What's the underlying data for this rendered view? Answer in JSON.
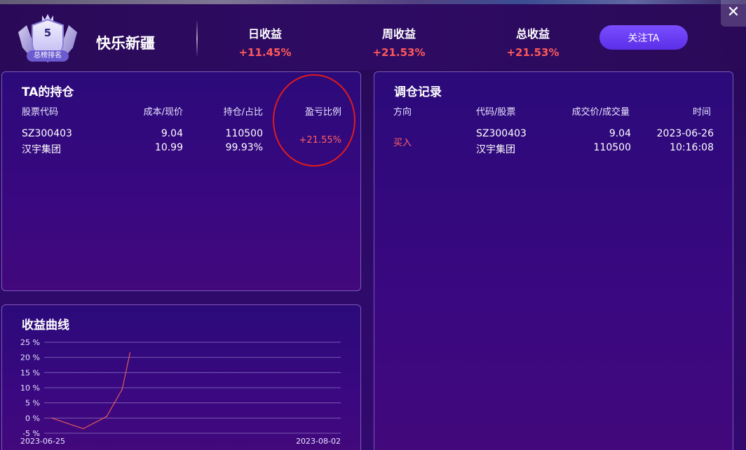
{
  "header": {
    "rank_number": "5",
    "rank_label": "总榜排名",
    "username": "快乐新疆",
    "stats": [
      {
        "label": "日收益",
        "value": "+11.45%"
      },
      {
        "label": "周收益",
        "value": "+21.53%"
      },
      {
        "label": "总收益",
        "value": "+21.53%"
      }
    ],
    "follow_label": "关注TA",
    "close_label": "✕"
  },
  "holdings": {
    "title": "TA的持仓",
    "columns": [
      "股票代码",
      "成本/现价",
      "持仓/占比",
      "盈亏比例"
    ],
    "rows": [
      {
        "code": "SZ300403",
        "name": "汉宇集团",
        "cost": "9.04",
        "price": "10.99",
        "position": "110500",
        "ratio": "99.93%",
        "pnl": "+21.55%"
      }
    ]
  },
  "records": {
    "title": "调仓记录",
    "columns": [
      "方向",
      "代码/股票",
      "成交价/成交量",
      "时间"
    ],
    "rows": [
      {
        "direction": "买入",
        "code": "SZ300403",
        "name": "汉宇集团",
        "price": "9.04",
        "volume": "110500",
        "date": "2023-06-26",
        "time": "10:16:08"
      }
    ]
  },
  "curve": {
    "title": "收益曲线"
  },
  "chart_data": {
    "type": "line",
    "title": "收益曲线",
    "ylim": [
      -5,
      25
    ],
    "yticks": [
      -5,
      0,
      5,
      10,
      15,
      20,
      25
    ],
    "ytick_labels": [
      "-5 %",
      "0 %",
      "5 %",
      "10 %",
      "15 %",
      "20 %",
      "25 %"
    ],
    "xlim": [
      "2023-06-25",
      "2023-08-02"
    ],
    "xtick_labels": [
      "2023-06-25",
      "2023-08-02"
    ],
    "grid": true,
    "series": [
      {
        "color": "#e05a5a",
        "x": [
          "2023-06-26",
          "2023-06-28",
          "2023-06-30",
          "2023-07-03",
          "2023-07-04",
          "2023-07-05",
          "2023-07-06"
        ],
        "y": [
          0,
          -1.8,
          -3.5,
          0.5,
          5,
          9.5,
          21.5
        ]
      }
    ]
  }
}
